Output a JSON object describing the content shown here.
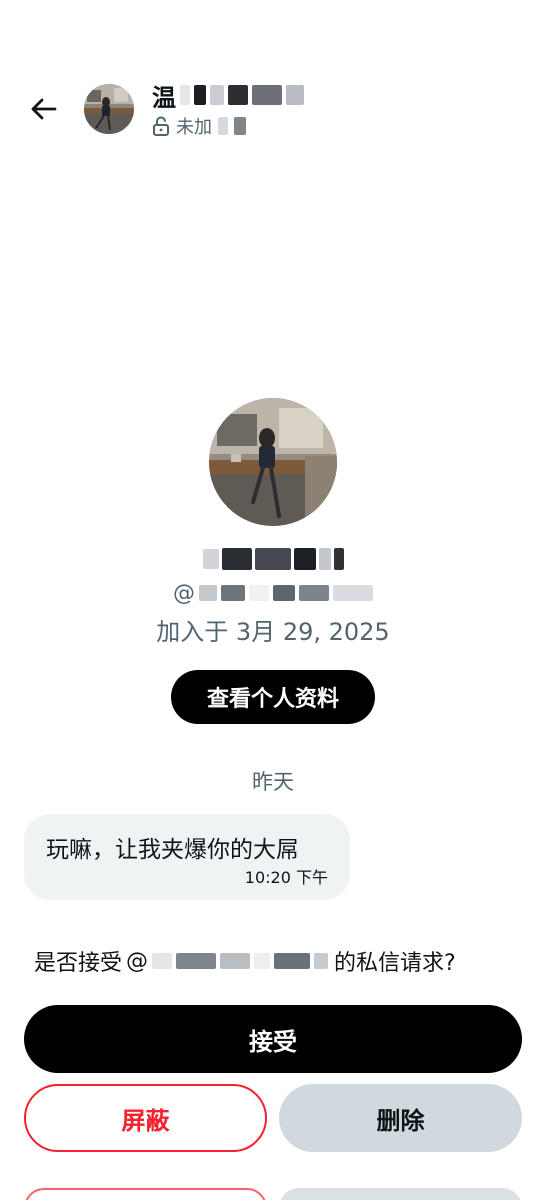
{
  "header": {
    "name_visible_char": "温",
    "status_label": "未加"
  },
  "profile": {
    "handle_prefix": "@",
    "joined": "加入于 3月 29, 2025",
    "view_profile_label": "查看个人资料"
  },
  "conversation": {
    "date_divider": "昨天",
    "message": {
      "text": "玩嘛，让我夹爆你的大屌",
      "time": "10:20 下午"
    }
  },
  "request": {
    "prompt_prefix": "是否接受",
    "handle_prefix": "@",
    "prompt_suffix": "的私信请求?",
    "accept_label": "接受",
    "block_label": "屏蔽",
    "delete_label": "删除"
  },
  "icons": {
    "back": "arrow-left-icon",
    "unlocked": "unlock-icon"
  },
  "colors": {
    "primary_text": "#0f1419",
    "secondary_text": "#536471",
    "danger": "#f4212e",
    "bubble_bg": "#eff3f4",
    "delete_bg": "#cfd9de",
    "accent_button": "#000000"
  }
}
